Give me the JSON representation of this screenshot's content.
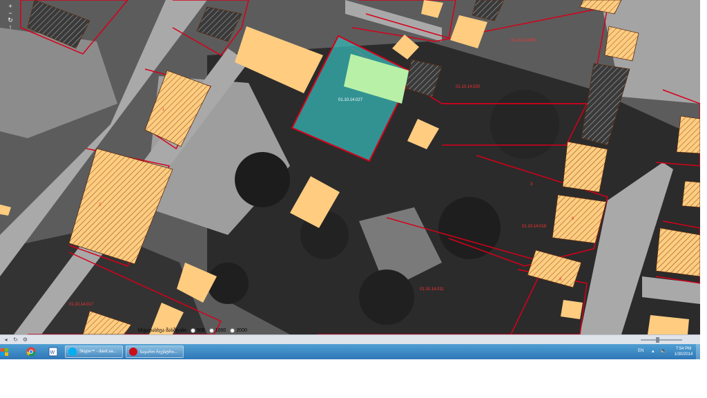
{
  "colors": {
    "building_fill": "#ffcc80",
    "parcel_line": "#d6001a",
    "selected_parcel": "#35b6b6",
    "overlay_green": "#b8f0a8",
    "road": "#a9a9a9",
    "taskbar": "#3b86c6"
  },
  "map": {
    "parcel_labels": [
      "01.10.14.009",
      "01.10.14.020",
      "01.10.14.018",
      "01.10.14.011",
      "01.10.14.017"
    ],
    "selected_parcel_label": "01.10.14.027",
    "small_labels": [
      "1",
      "2",
      "3",
      "6",
      "8"
    ],
    "nav_icons": [
      "plus-icon",
      "minus-icon",
      "refresh-icon",
      "arrow-icon",
      "home-icon"
    ]
  },
  "scale_selector": {
    "label": "სხვადასხვა მასშტაბი",
    "options": [
      "500",
      "1000",
      "2000"
    ]
  },
  "statusbar": {
    "icons": [
      "back-icon",
      "refresh-icon",
      "settings-icon"
    ]
  },
  "taskbar": {
    "pinned": [
      "windows-orb",
      "chrome-icon",
      "word-icon"
    ],
    "buttons": [
      {
        "label": "Skype™ - davit.sa...",
        "icon": "skype-icon"
      },
      {
        "label": "საჯარო რეესტრი...",
        "icon": "opera-icon"
      }
    ],
    "language": "EN",
    "time": "7:54 PM",
    "date": "1/30/2014"
  }
}
